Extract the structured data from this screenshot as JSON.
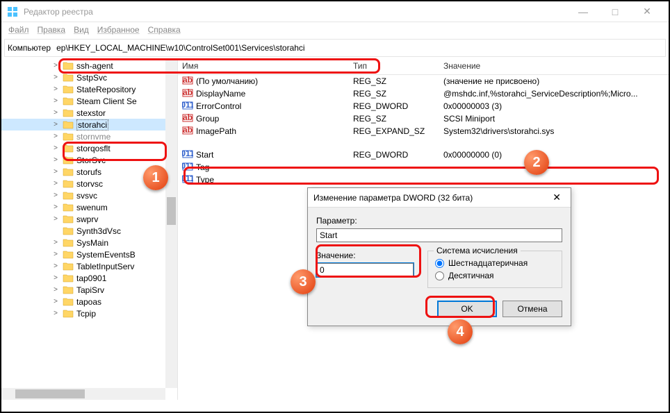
{
  "window": {
    "title": "Редактор реестра",
    "min": "—",
    "max": "□",
    "close": "✕"
  },
  "menu": {
    "file": "Файл",
    "edit": "Правка",
    "view": "Вид",
    "favorites": "Избранное",
    "help": "Справка"
  },
  "address": {
    "label": "Компьютер",
    "path": "ер\\HKEY_LOCAL_MACHINE\\w10\\ControlSet001\\Services\\storahci"
  },
  "tree": [
    {
      "label": "ssh-agent",
      "expand": ">"
    },
    {
      "label": "SstpSvc",
      "expand": ">"
    },
    {
      "label": "StateRepository",
      "expand": ">"
    },
    {
      "label": "Steam Client Se",
      "expand": ">"
    },
    {
      "label": "stexstor",
      "expand": ">"
    },
    {
      "label": "storahci",
      "expand": ">",
      "selected": true,
      "faded": false
    },
    {
      "label": "stornvme",
      "expand": ">",
      "faded": true
    },
    {
      "label": "storqosflt",
      "expand": ">"
    },
    {
      "label": "StorSvc",
      "expand": ">"
    },
    {
      "label": "storufs",
      "expand": ">"
    },
    {
      "label": "storvsc",
      "expand": ">"
    },
    {
      "label": "svsvc",
      "expand": ">"
    },
    {
      "label": "swenum",
      "expand": ">"
    },
    {
      "label": "swprv",
      "expand": ">"
    },
    {
      "label": "Synth3dVsc",
      "expand": ""
    },
    {
      "label": "SysMain",
      "expand": ">"
    },
    {
      "label": "SystemEventsB",
      "expand": ">"
    },
    {
      "label": "TabletInputServ",
      "expand": ">"
    },
    {
      "label": "tap0901",
      "expand": ">"
    },
    {
      "label": "TapiSrv",
      "expand": ">"
    },
    {
      "label": "tapoas",
      "expand": ">"
    },
    {
      "label": "Tcpip",
      "expand": ">"
    }
  ],
  "columns": {
    "name": "Имя",
    "type": "Тип",
    "value": "Значение"
  },
  "values": [
    {
      "icon": "str",
      "name": "(По умолчанию)",
      "type": "REG_SZ",
      "value": "(значение не присвоено)"
    },
    {
      "icon": "str",
      "name": "DisplayName",
      "type": "REG_SZ",
      "value": "@mshdc.inf,%storahci_ServiceDescription%;Micro..."
    },
    {
      "icon": "bin",
      "name": "ErrorControl",
      "type": "REG_DWORD",
      "value": "0x00000003 (3)"
    },
    {
      "icon": "str",
      "name": "Group",
      "type": "REG_SZ",
      "value": "SCSI Miniport"
    },
    {
      "icon": "str",
      "name": "ImagePath",
      "type": "REG_EXPAND_SZ",
      "value": "System32\\drivers\\storahci.sys"
    },
    {
      "icon": "bin",
      "name": "Start",
      "type": "REG_DWORD",
      "value": "0x00000000 (0)",
      "highlight": true
    },
    {
      "icon": "bin",
      "name": "Tag",
      "type": "",
      "value": ""
    },
    {
      "icon": "bin",
      "name": "Type",
      "type": "",
      "value": ""
    }
  ],
  "dialog": {
    "title": "Изменение параметра DWORD (32 бита)",
    "param_label": "Параметр:",
    "param_value": "Start",
    "value_label": "Значение:",
    "value_input": "0",
    "radix_label": "Система исчисления",
    "radix_hex": "Шестнадцатеричная",
    "radix_dec": "Десятичная",
    "ok": "OK",
    "cancel": "Отмена",
    "close": "✕"
  },
  "callouts": {
    "n1": "1",
    "n2": "2",
    "n3": "3",
    "n4": "4"
  }
}
